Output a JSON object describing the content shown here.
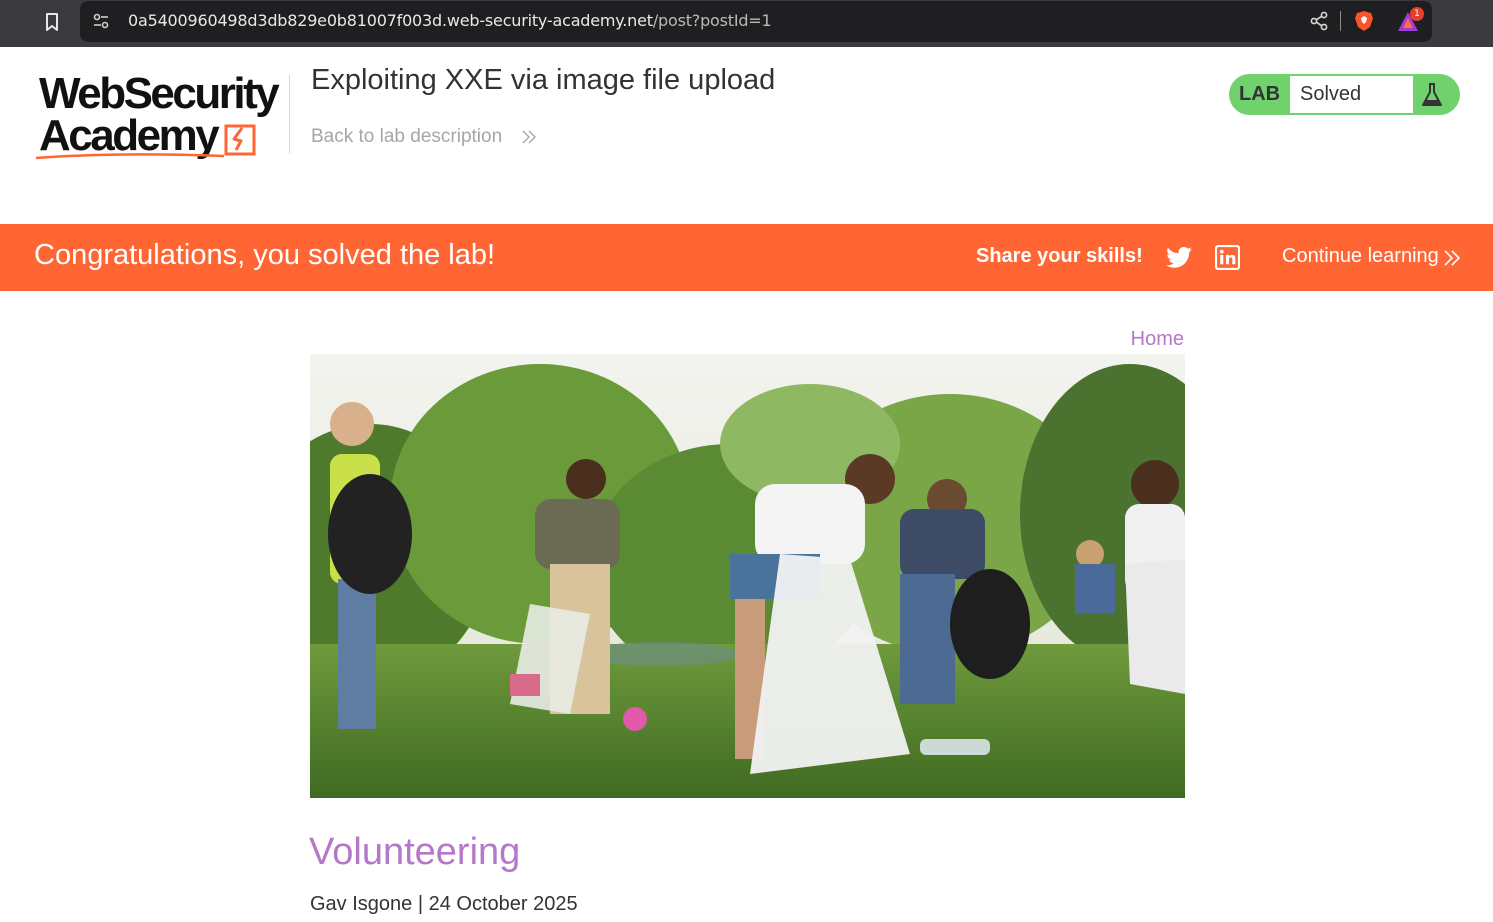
{
  "browser": {
    "url_host": "0a5400960498d3db829e0b81007f003d.web-security-academy.net",
    "url_path": "/post?postId=1",
    "rewards_badge": "1"
  },
  "header": {
    "logo_line1": "WebSecurity",
    "logo_line2": "Academy",
    "lab_title": "Exploiting XXE via image file upload",
    "back_link": "Back to lab description",
    "lab_label": "LAB",
    "lab_status": "Solved"
  },
  "banner": {
    "message": "Congratulations, you solved the lab!",
    "share_label": "Share your skills!",
    "continue_label": "Continue learning"
  },
  "content": {
    "home_link": "Home",
    "post_title": "Volunteering",
    "post_meta": "Gav Isgone | 24 October 2025"
  },
  "colors": {
    "accent_orange": "#ff6633",
    "lab_green": "#70d16d",
    "link_purple": "#b577c8",
    "browser_bg": "#3b3b3f"
  },
  "icons": [
    "bookmark-icon",
    "site-settings-icon",
    "share-icon",
    "brave-shield-icon",
    "brave-rewards-icon",
    "flask-icon",
    "twitter-icon",
    "linkedin-icon",
    "double-chevron-right-icon"
  ]
}
